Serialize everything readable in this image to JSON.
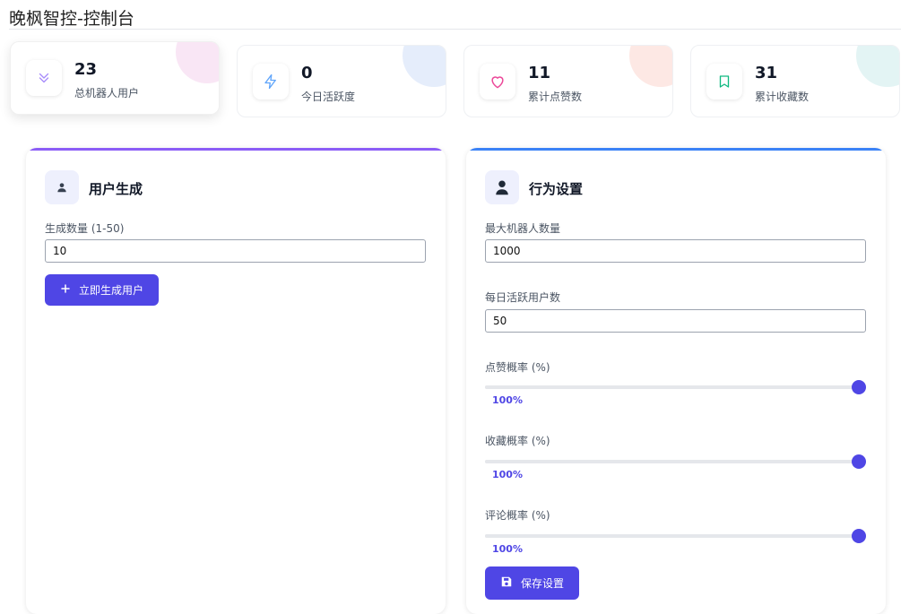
{
  "header": {
    "title": "晚枫智控-控制台"
  },
  "stats": [
    {
      "value": "23",
      "label": "总机器人用户",
      "icon": "chevrons-down-icon",
      "color": "#a78bfa",
      "blob": "#f9e6f5"
    },
    {
      "value": "0",
      "label": "今日活跃度",
      "icon": "lightning-icon",
      "color": "#60a5fa",
      "blob": "#e5edfb"
    },
    {
      "value": "11",
      "label": "累计点赞数",
      "icon": "heart-icon",
      "color": "#ec4899",
      "blob": "#fde8e4"
    },
    {
      "value": "31",
      "label": "累计收藏数",
      "icon": "bookmark-icon",
      "color": "#10b981",
      "blob": "#e3f4f4"
    }
  ],
  "user_panel": {
    "title": "用户生成",
    "count_label": "生成数量 (1-50)",
    "count_value": "10",
    "generate_button": "立即生成用户",
    "accent": "#8b5cf6"
  },
  "behavior_panel": {
    "title": "行为设置",
    "max_bots_label": "最大机器人数量",
    "max_bots_value": "1000",
    "daily_active_label": "每日活跃用户数",
    "daily_active_value": "50",
    "sliders": [
      {
        "label": "点赞概率 (%)",
        "value": 100,
        "readout": "100%"
      },
      {
        "label": "收藏概率 (%)",
        "value": 100,
        "readout": "100%"
      },
      {
        "label": "评论概率 (%)",
        "value": 100,
        "readout": "100%"
      }
    ],
    "save_button": "保存设置",
    "accent": "#3b82f6"
  }
}
